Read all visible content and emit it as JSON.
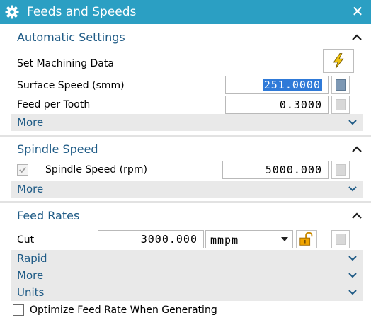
{
  "window": {
    "title": "Feeds and Speeds",
    "close_glyph": "✕"
  },
  "automatic": {
    "header": "Automatic Settings",
    "set_machining_data": "Set Machining Data",
    "surface_speed_label": "Surface Speed (smm)",
    "surface_speed_value": "251.0000",
    "feed_per_tooth_label": "Feed per Tooth",
    "feed_per_tooth_value": "0.3000",
    "more": "More"
  },
  "spindle": {
    "header": "Spindle Speed",
    "checkbox_checked": true,
    "label": "Spindle Speed (rpm)",
    "value": "5000.000",
    "more": "More"
  },
  "feed_rates": {
    "header": "Feed Rates",
    "cut_label": "Cut",
    "cut_value": "3000.000",
    "cut_unit": "mmpm",
    "rapid": "Rapid",
    "more": "More",
    "units": "Units"
  },
  "optimize": {
    "label": "Optimize Feed Rate When Generating",
    "checked": false
  },
  "colors": {
    "titlebar": "#2b9fc3",
    "section_header": "#1f5b86",
    "selection": "#2f7ad8",
    "lock": "#f0a500"
  },
  "icons": [
    "gear-icon",
    "close-icon",
    "chevron-up-icon",
    "chevron-down-icon",
    "lightning-icon",
    "calculator-icon",
    "lock-open-icon",
    "checkbox-icon"
  ]
}
